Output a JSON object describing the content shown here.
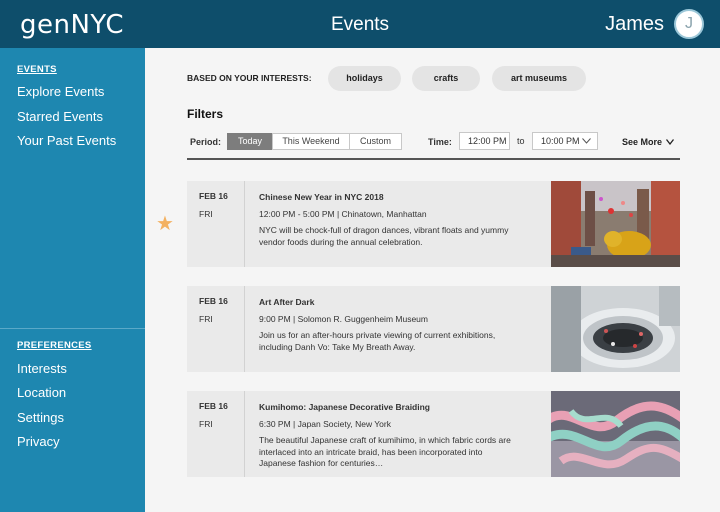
{
  "header": {
    "logo": "genNYC",
    "title": "Events",
    "user_name": "James",
    "avatar_initial": "J"
  },
  "sidebar": {
    "events_heading": "EVENTS",
    "event_items": [
      {
        "label": "Explore Events"
      },
      {
        "label": "Starred Events"
      },
      {
        "label": "Your Past Events"
      }
    ],
    "preferences_heading": "PREFERENCES",
    "preference_items": [
      {
        "label": "Interests"
      },
      {
        "label": "Location"
      },
      {
        "label": "Settings"
      },
      {
        "label": "Privacy"
      }
    ]
  },
  "interests": {
    "label": "BASED ON YOUR INTERESTS:",
    "chips": [
      "holidays",
      "crafts",
      "art museums"
    ]
  },
  "filters": {
    "title": "Filters",
    "period_label": "Period:",
    "period_options": [
      "Today",
      "This Weekend",
      "Custom"
    ],
    "selected_period": "Today",
    "time_label": "Time:",
    "time_from": "12:00 PM",
    "to_label": "to",
    "time_to": "10:00 PM",
    "see_more": "See More"
  },
  "events": [
    {
      "date": "FEB 16",
      "day": "FRI",
      "title": "Chinese New Year in NYC 2018",
      "meta": "12:00 PM - 5:00 PM | Chinatown, Manhattan",
      "description": "NYC will be chock-full of dragon dances, vibrant floats and yummy vendor foods during the annual celebration.",
      "starred": true
    },
    {
      "date": "FEB 16",
      "day": "FRI",
      "title": "Art After Dark",
      "meta": "9:00 PM | Solomon R. Guggenheim Museum",
      "description": "Join us for an after-hours private viewing of current exhibitions, including Danh Vo: Take My Breath Away.",
      "starred": false
    },
    {
      "date": "FEB 16",
      "day": "FRI",
      "title": "Kumihomo: Japanese Decorative Braiding",
      "meta": "6:30 PM | Japan Society, New York",
      "description": "The beautiful Japanese craft of kumihimo, in which fabric cords are interlaced into an intricate braid, has been incorporated into Japanese fashion for centuries…",
      "starred": false
    }
  ],
  "colors": {
    "header_bg": "#0e4e6b",
    "sidebar_bg": "#1e87b0",
    "star": "#f3b161",
    "active_segment": "#7d7d7d"
  },
  "icons": {
    "star": "star-icon",
    "dropdown": "chevron-down-icon"
  }
}
